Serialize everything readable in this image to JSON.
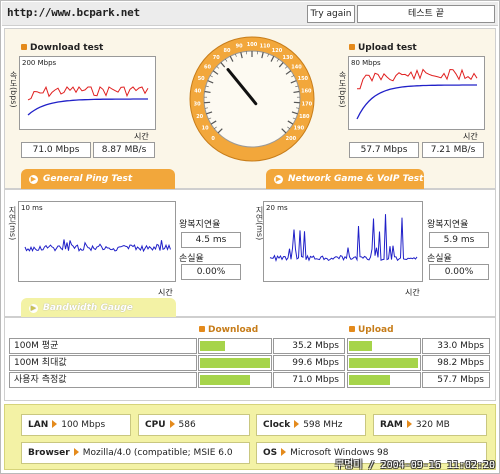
{
  "site_url": "http://www.bcpark.net",
  "header": {
    "try_again": "Try again",
    "test_input_value": "테스트 끝"
  },
  "download": {
    "title": "Download test",
    "ylabel": "속도(bps)",
    "xlabel": "시간",
    "scale": "200 Mbps",
    "value_mbps": "71.0 Mbps",
    "value_mbs": "8.87 MB/s"
  },
  "upload": {
    "title": "Upload test",
    "ylabel": "속도(bps)",
    "xlabel": "시간",
    "scale": "80 Mbps",
    "value_mbps": "57.7 Mbps",
    "value_mbs": "7.21 MB/s"
  },
  "speedometer": {
    "ticks": [
      "0",
      "10",
      "20",
      "30",
      "40",
      "50",
      "60",
      "70",
      "80",
      "90",
      "100",
      "110",
      "120",
      "130",
      "140",
      "150",
      "160",
      "170",
      "180",
      "190",
      "200"
    ],
    "needle_value": 71
  },
  "tabs": {
    "general_ping": "General Ping Test",
    "network_game": "Network Game & VoIP Test",
    "bandwidth_gauge": "Bandwidth Gauge"
  },
  "ping_general": {
    "ylabel": "지연(ms)",
    "xlabel": "시간",
    "scale": "10 ms",
    "latency_label": "왕복지연율",
    "latency_value": "4.5 ms",
    "loss_label": "손실율",
    "loss_value": "0.00%"
  },
  "ping_game": {
    "ylabel": "지연(ms)",
    "xlabel": "시간",
    "scale": "20 ms",
    "latency_label": "왕복지연율",
    "latency_value": "5.9 ms",
    "loss_label": "손실율",
    "loss_value": "0.00%"
  },
  "bandwidth": {
    "download_header": "Download",
    "upload_header": "Upload",
    "rows": [
      {
        "label": "100M 평균",
        "download": "35.2 Mbps",
        "download_fraction": 0.35,
        "upload": "33.0 Mbps",
        "upload_fraction": 0.33
      },
      {
        "label": "100M 최대값",
        "download": "99.6 Mbps",
        "download_fraction": 1.0,
        "upload": "98.2 Mbps",
        "upload_fraction": 0.98
      },
      {
        "label": "사용자 측정값",
        "download": "71.0 Mbps",
        "download_fraction": 0.71,
        "upload": "57.7 Mbps",
        "upload_fraction": 0.58
      }
    ]
  },
  "system_info": {
    "lan_label": "LAN",
    "lan_value": "100 Mbps",
    "cpu_label": "CPU",
    "cpu_value": "586",
    "clock_label": "Clock",
    "clock_value": "598 MHz",
    "ram_label": "RAM",
    "ram_value": "320 MB",
    "browser_label": "Browser",
    "browser_value": "Mozilla/4.0 (compatible; MSIE 6.0",
    "os_label": "OS",
    "os_value": "Microsoft Windows 98"
  },
  "footer_stamp": "무명미 / 2004-09-16 11:02:20",
  "colors": {
    "accent_orange": "#f2a73b",
    "bar_green": "#a6d44a",
    "info_yellow": "#f3f2a5",
    "line_red": "#e02020",
    "line_blue": "#2020c8"
  }
}
